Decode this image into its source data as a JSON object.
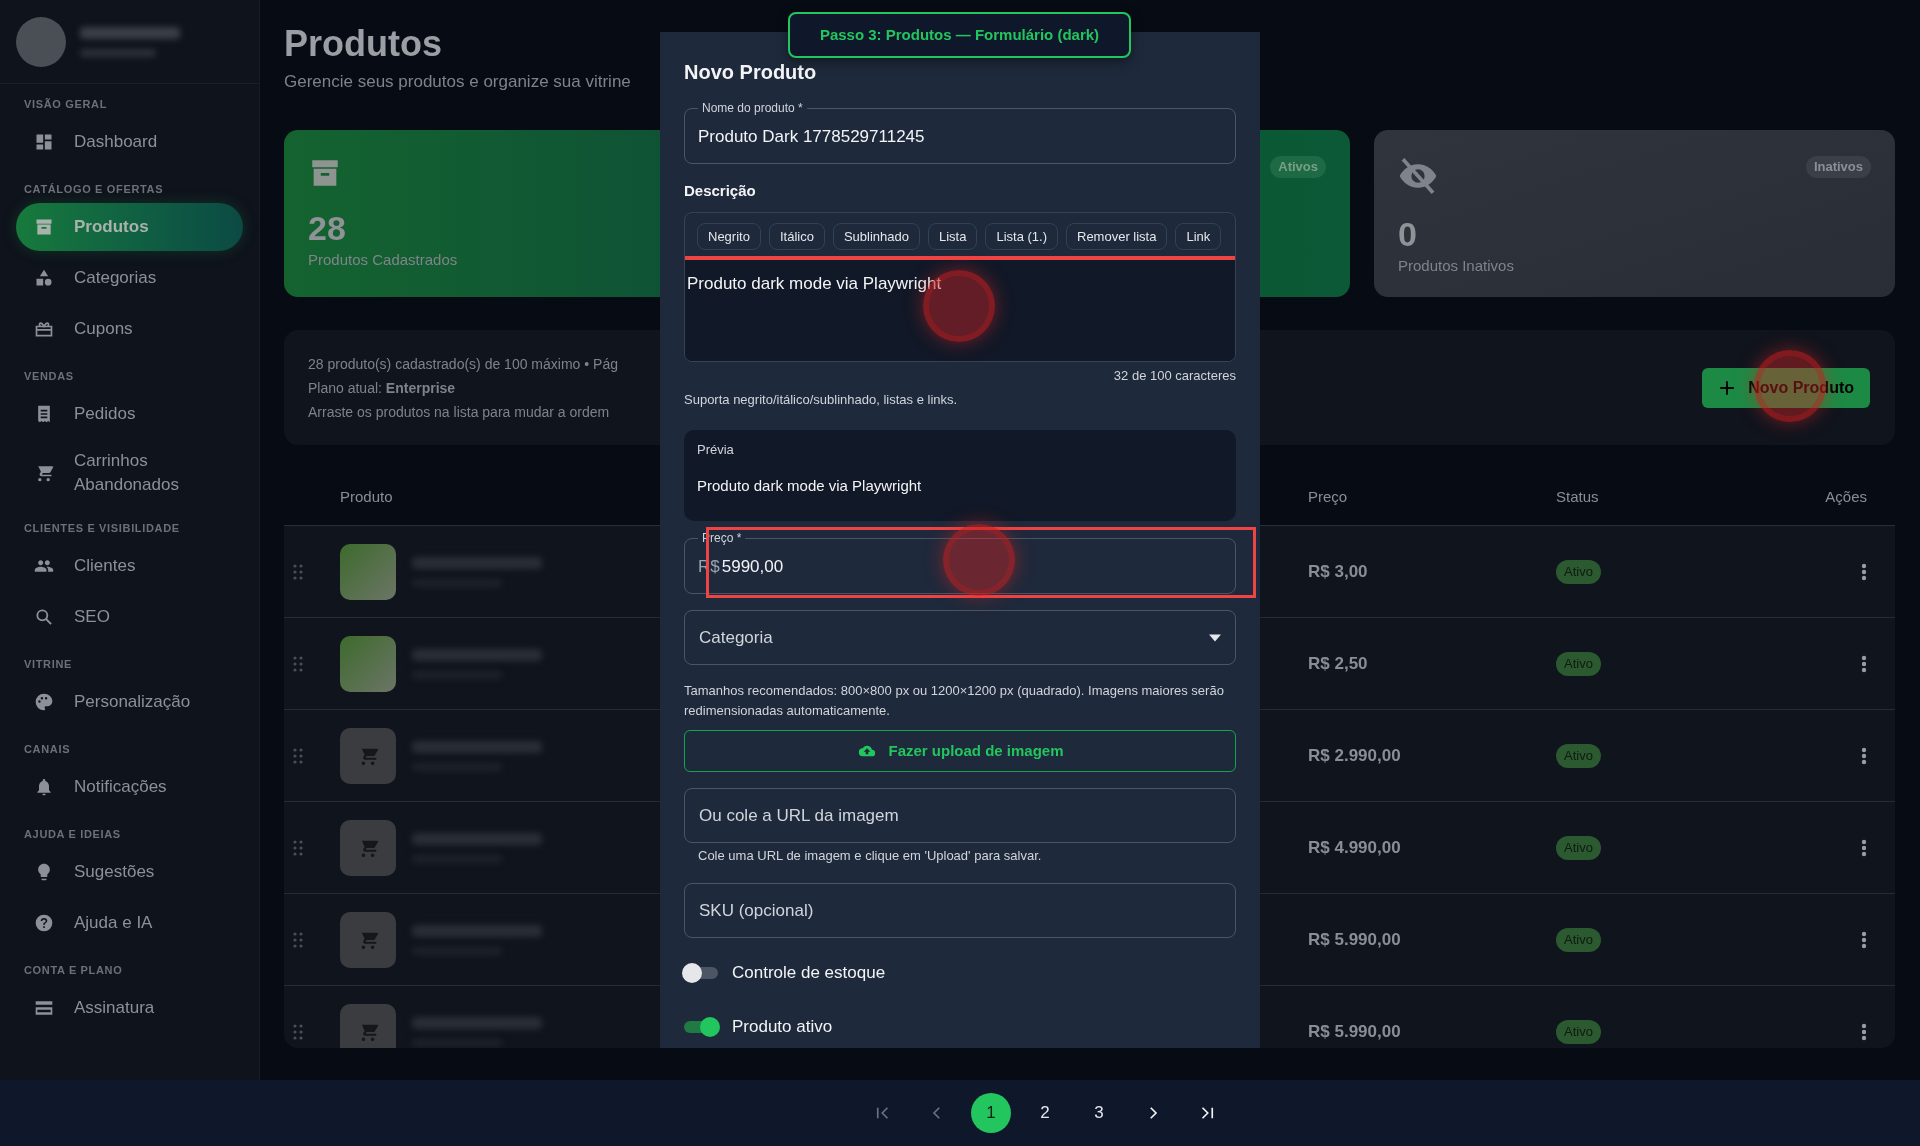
{
  "sidebar": {
    "sections": [
      {
        "title": "VISÃO GERAL",
        "items": [
          {
            "label": "Dashboard",
            "selected": false
          }
        ]
      },
      {
        "title": "CATÁLOGO E OFERTAS",
        "items": [
          {
            "label": "Produtos",
            "selected": true
          },
          {
            "label": "Categorias",
            "selected": false
          },
          {
            "label": "Cupons",
            "selected": false
          }
        ]
      },
      {
        "title": "VENDAS",
        "items": [
          {
            "label": "Pedidos",
            "selected": false
          },
          {
            "label": "Carrinhos Abandonados",
            "selected": false
          }
        ]
      },
      {
        "title": "CLIENTES E VISIBILIDADE",
        "items": [
          {
            "label": "Clientes",
            "selected": false
          },
          {
            "label": "SEO",
            "selected": false
          }
        ]
      },
      {
        "title": "VITRINE",
        "items": [
          {
            "label": "Personalização",
            "selected": false
          }
        ]
      },
      {
        "title": "CANAIS",
        "items": [
          {
            "label": "Notificações",
            "selected": false
          }
        ]
      },
      {
        "title": "AJUDA E IDEIAS",
        "items": [
          {
            "label": "Sugestões",
            "selected": false
          },
          {
            "label": "Ajuda e IA",
            "selected": false
          }
        ]
      },
      {
        "title": "CONTA E PLANO",
        "items": [
          {
            "label": "Assinatura",
            "selected": false
          }
        ]
      }
    ]
  },
  "header": {
    "title": "Produtos",
    "subtitle": "Gerencie seus produtos e organize sua vitrine"
  },
  "stats": [
    {
      "kind": "total",
      "value": "28",
      "label": "Produtos Cadastrados"
    },
    {
      "kind": "active",
      "badge": "Ativos"
    },
    {
      "kind": "inactive",
      "value": "0",
      "label": "Produtos Inativos",
      "badge": "Inativos"
    }
  ],
  "summary": {
    "lines": [
      "28 produto(s) cadastrado(s) de 100 máximo • Pág",
      "Plano atual: **Enterprise**",
      "Arraste os produtos na lista para mudar a ordem"
    ],
    "button": "Novo Produto"
  },
  "table": {
    "columns": [
      "Produto",
      "Preço",
      "Status",
      "Ações"
    ],
    "rows": [
      {
        "kind": "photo",
        "price": "R$ 3,00",
        "status": "Ativo"
      },
      {
        "kind": "photo",
        "price": "R$ 2,50",
        "status": "Ativo"
      },
      {
        "kind": "placeholder",
        "price": "R$ 2.990,00",
        "status": "Ativo"
      },
      {
        "kind": "placeholder",
        "price": "R$ 4.990,00",
        "status": "Ativo"
      },
      {
        "kind": "placeholder",
        "price": "R$ 5.990,00",
        "status": "Ativo"
      },
      {
        "kind": "placeholder",
        "price": "R$ 5.990,00",
        "status": "Ativo"
      }
    ]
  },
  "banner": "Passo 3: Produtos — Formulário (dark)",
  "modal": {
    "title": "Novo Produto",
    "name_field": {
      "label": "Nome do produto *",
      "value": "Produto Dark 1778529711245"
    },
    "description": {
      "heading": "Descrição",
      "toolbar": [
        "Negrito",
        "Itálico",
        "Sublinhado",
        "Lista",
        "Lista (1.)",
        "Remover lista",
        "Link"
      ],
      "text": "Produto dark mode via Playwright",
      "counter": "32 de 100 caracteres",
      "hint": "Suporta negrito/itálico/sublinhado, listas e links."
    },
    "preview": {
      "label": "Prévia",
      "text": "Produto dark mode via Playwright"
    },
    "price_field": {
      "label": "Preço *",
      "prefix": "R$",
      "value": "5990,00"
    },
    "category_select": {
      "placeholder": "Categoria"
    },
    "image_hint": "Tamanhos recomendados: 800×800 px ou 1200×1200 px (quadrado). Imagens maiores serão redimensionadas automaticamente.",
    "upload_button": "Fazer upload de imagem",
    "url_field": {
      "placeholder": "Ou cole a URL da imagem",
      "helper": "Cole uma URL de imagem e clique em 'Upload' para salvar."
    },
    "sku_field": {
      "placeholder": "SKU (opcional)"
    },
    "toggles": [
      {
        "label": "Controle de estoque",
        "on": false
      },
      {
        "label": "Produto ativo",
        "on": true
      }
    ]
  },
  "pagination": {
    "pages": [
      {
        "label": "1",
        "selected": true
      },
      {
        "label": "2",
        "selected": false
      },
      {
        "label": "3",
        "selected": false
      }
    ]
  }
}
